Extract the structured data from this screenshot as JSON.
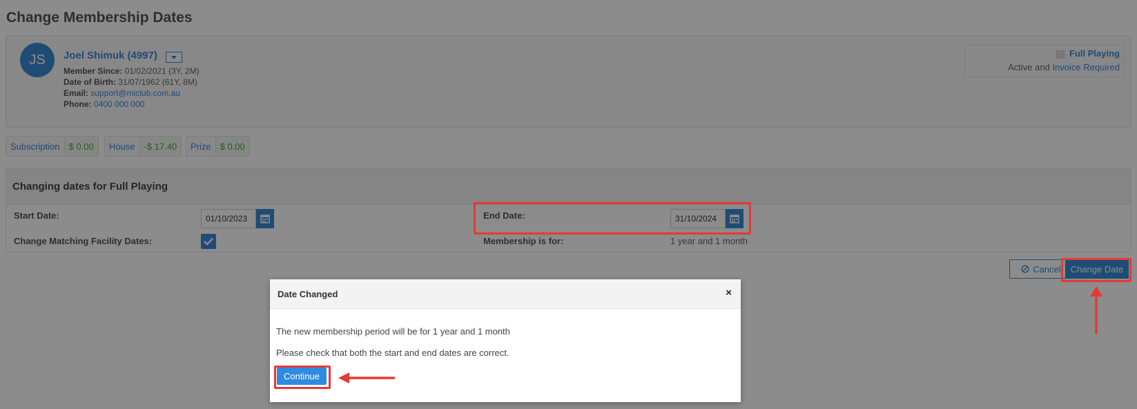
{
  "page": {
    "title": "Change Membership Dates"
  },
  "member": {
    "initials": "JS",
    "name": "Joel Shimuk (4997)",
    "since_label": "Member Since:",
    "since_value": "01/02/2021 (3Y, 2M)",
    "dob_label": "Date of Birth:",
    "dob_value": "31/07/1962 (61Y, 8M)",
    "email_label": "Email:",
    "email_value": "support@miclub.com.au",
    "phone_label": "Phone:",
    "phone_value": "0400 000 000",
    "plan": "Full Playing",
    "status_prefix": "Active and ",
    "status_link": "Invoice Required"
  },
  "balances": [
    {
      "label": "Subscription",
      "amount": "$ 0.00"
    },
    {
      "label": "House",
      "amount": "-$ 17.40"
    },
    {
      "label": "Prize",
      "amount": "$ 0.00"
    }
  ],
  "dates": {
    "heading": "Changing dates for Full Playing",
    "start_label": "Start Date:",
    "start_value": "01/10/2023",
    "end_label": "End Date:",
    "end_value": "31/10/2024",
    "matching_label": "Change Matching Facility Dates:",
    "matching_checked": true,
    "period_label": "Membership is for:",
    "period_value": "1 year and 1 month"
  },
  "actions": {
    "cancel": "Cancel",
    "change": "Change Date"
  },
  "modal": {
    "title": "Date Changed",
    "close_icon": "×",
    "line1": "The new membership period will be for 1 year and 1 month",
    "line2": "Please check that both the start and end dates are correct.",
    "continue": "Continue"
  },
  "colors": {
    "accent": "#3a8ad6",
    "highlight": "#e53935",
    "positive": "#46a546"
  }
}
